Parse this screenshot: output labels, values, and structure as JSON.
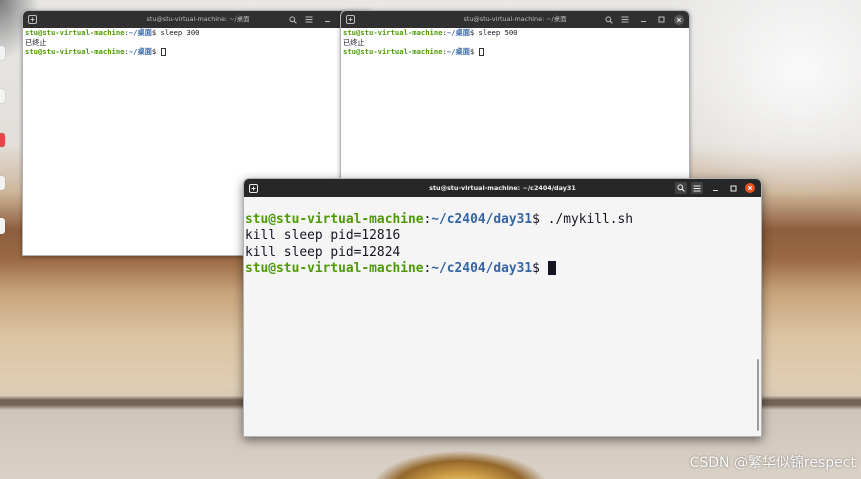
{
  "colors": {
    "prompt_user": "#4e9a06",
    "prompt_path": "#3465a4",
    "terminal_text": "#171421",
    "titlebar_bg": "#303030",
    "titlebar_active_bg": "#272727",
    "close_active": "#e95420"
  },
  "titlebar_icons": [
    "new-tab-icon",
    "search-icon",
    "menu-icon",
    "minimize-icon",
    "maximize-icon",
    "close-icon"
  ],
  "terminals": {
    "left": {
      "title": "stu@stu-virtual-machine: ~/桌面",
      "lines": [
        {
          "user": "stu@stu-virtual-machine",
          "sep": ":",
          "path": "~/桌面",
          "cmd": "$ sleep 300"
        },
        {
          "text": "已终止"
        },
        {
          "user": "stu@stu-virtual-machine",
          "sep": ":",
          "path": "~/桌面",
          "cmd": "$ "
        }
      ]
    },
    "right": {
      "title": "stu@stu-virtual-machine: ~/桌面",
      "lines": [
        {
          "user": "stu@stu-virtual-machine",
          "sep": ":",
          "path": "~/桌面",
          "cmd": "$ sleep 500"
        },
        {
          "text": "已终止"
        },
        {
          "user": "stu@stu-virtual-machine",
          "sep": ":",
          "path": "~/桌面",
          "cmd": "$ "
        }
      ]
    },
    "front": {
      "title": "stu@stu-virtual-machine: ~/c2404/day31",
      "lines": [
        {
          "user": "stu@stu-virtual-machine",
          "sep": ":",
          "path": "~/c2404/day31",
          "cmd": "$ ./mykill.sh"
        },
        {
          "text": "kill sleep pid=12816"
        },
        {
          "text": "kill sleep pid=12824"
        },
        {
          "user": "stu@stu-virtual-machine",
          "sep": ":",
          "path": "~/c2404/day31",
          "cmd": "$ "
        }
      ]
    }
  },
  "desktop": {
    "watermark": "CSDN @繁华似锦respect"
  }
}
